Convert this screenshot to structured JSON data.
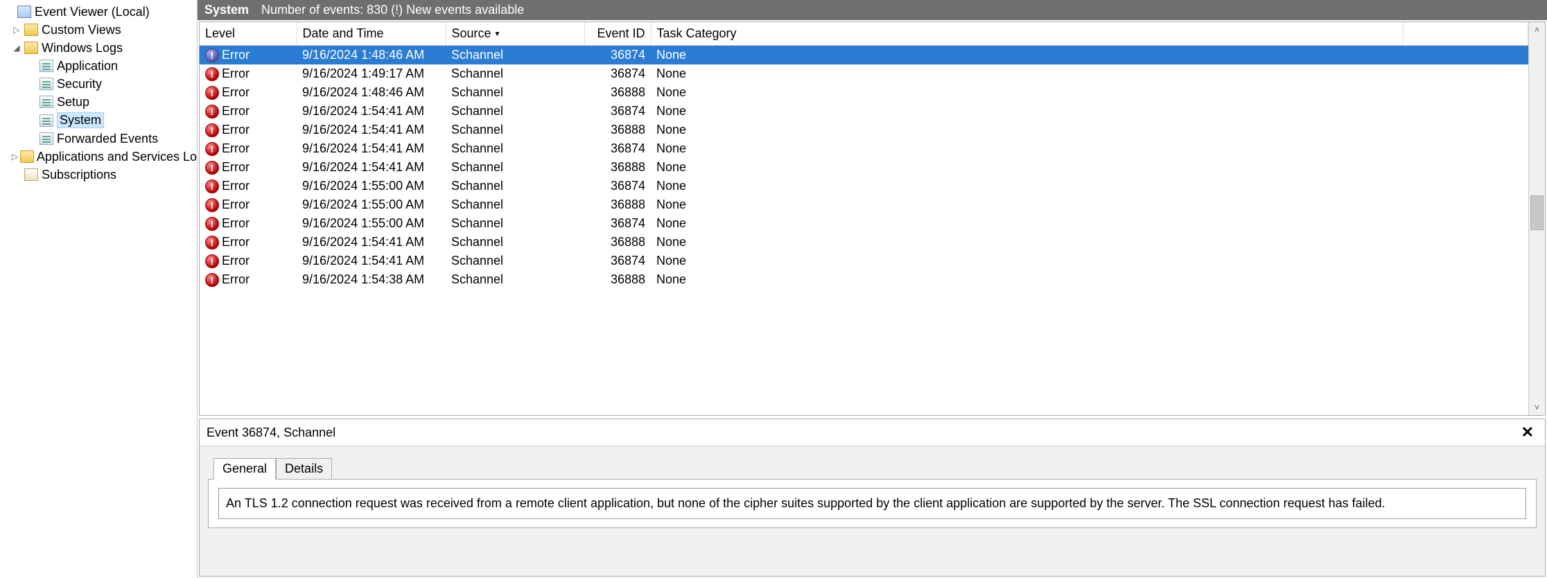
{
  "tree": {
    "root": "Event Viewer (Local)",
    "customViews": "Custom Views",
    "windowsLogs": "Windows Logs",
    "application": "Application",
    "security": "Security",
    "setup": "Setup",
    "system": "System",
    "forwarded": "Forwarded Events",
    "appsServices": "Applications and Services Lo",
    "subscriptions": "Subscriptions"
  },
  "header": {
    "title": "System",
    "subtitle": "Number of events: 830 (!) New events available"
  },
  "columns": {
    "level": "Level",
    "date": "Date and Time",
    "source": "Source",
    "eventId": "Event ID",
    "taskCat": "Task Category"
  },
  "events": [
    {
      "level": "Error",
      "date": "9/16/2024 1:48:46 AM",
      "source": "Schannel",
      "eventId": "36874",
      "taskCat": "None",
      "selected": true
    },
    {
      "level": "Error",
      "date": "9/16/2024 1:49:17 AM",
      "source": "Schannel",
      "eventId": "36874",
      "taskCat": "None"
    },
    {
      "level": "Error",
      "date": "9/16/2024 1:48:46 AM",
      "source": "Schannel",
      "eventId": "36888",
      "taskCat": "None"
    },
    {
      "level": "Error",
      "date": "9/16/2024 1:54:41 AM",
      "source": "Schannel",
      "eventId": "36874",
      "taskCat": "None"
    },
    {
      "level": "Error",
      "date": "9/16/2024 1:54:41 AM",
      "source": "Schannel",
      "eventId": "36888",
      "taskCat": "None"
    },
    {
      "level": "Error",
      "date": "9/16/2024 1:54:41 AM",
      "source": "Schannel",
      "eventId": "36874",
      "taskCat": "None"
    },
    {
      "level": "Error",
      "date": "9/16/2024 1:54:41 AM",
      "source": "Schannel",
      "eventId": "36888",
      "taskCat": "None"
    },
    {
      "level": "Error",
      "date": "9/16/2024 1:55:00 AM",
      "source": "Schannel",
      "eventId": "36874",
      "taskCat": "None"
    },
    {
      "level": "Error",
      "date": "9/16/2024 1:55:00 AM",
      "source": "Schannel",
      "eventId": "36888",
      "taskCat": "None"
    },
    {
      "level": "Error",
      "date": "9/16/2024 1:55:00 AM",
      "source": "Schannel",
      "eventId": "36874",
      "taskCat": "None"
    },
    {
      "level": "Error",
      "date": "9/16/2024 1:54:41 AM",
      "source": "Schannel",
      "eventId": "36888",
      "taskCat": "None"
    },
    {
      "level": "Error",
      "date": "9/16/2024 1:54:41 AM",
      "source": "Schannel",
      "eventId": "36874",
      "taskCat": "None"
    },
    {
      "level": "Error",
      "date": "9/16/2024 1:54:38 AM",
      "source": "Schannel",
      "eventId": "36888",
      "taskCat": "None"
    }
  ],
  "details": {
    "title": "Event 36874, Schannel",
    "tabGeneral": "General",
    "tabDetails": "Details",
    "message": "An TLS 1.2 connection request was received from a remote client application, but none of the cipher suites supported by the client application are supported by the server. The SSL connection request has failed."
  }
}
